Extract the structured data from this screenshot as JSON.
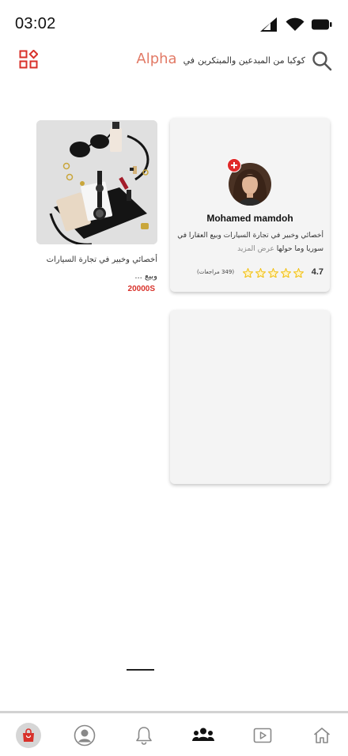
{
  "status_bar": {
    "time": "03:02"
  },
  "header": {
    "brand": "Alpha",
    "title_before": "في",
    "title_after": "كوكبا من المبدعين والمبتكرين"
  },
  "profile_card": {
    "name": "Mohamed mamdoh",
    "description": "أخصائي وخبير في تجارة السيارات وبيع العقارا في سوريا وما حولها",
    "more_link": "عرض المزيد",
    "rating": "4.7",
    "stars": 5,
    "reviews": "(349 مراجعات)"
  },
  "product": {
    "title": "أخصائي وخبير في تجارة السيارات وبيع ...",
    "price": "20000S"
  },
  "bottom_nav": {
    "items": [
      {
        "icon": "shopping-bag-icon",
        "active": true
      },
      {
        "icon": "profile-icon",
        "active": false
      },
      {
        "icon": "bell-icon",
        "active": false
      },
      {
        "icon": "people-icon",
        "active": false
      },
      {
        "icon": "play-video-icon",
        "active": false
      },
      {
        "icon": "home-icon",
        "active": false
      }
    ]
  },
  "colors": {
    "brand": "#e27a66",
    "accent_red": "#d8312a",
    "badge_red": "#e02a2a",
    "star": "#f2c21b"
  }
}
